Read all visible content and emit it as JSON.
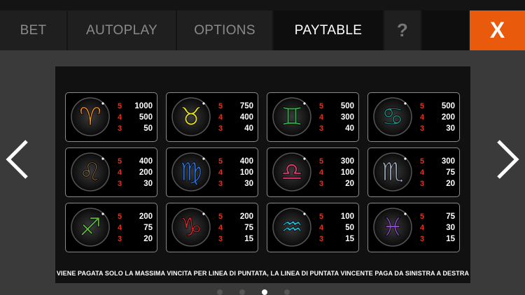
{
  "tabs": {
    "bet": "BET",
    "autoplay": "AUTOPLAY",
    "options": "OPTIONS",
    "paytable": "PAYTABLE",
    "help": "?",
    "close": "X"
  },
  "paytable": {
    "note": "VIENE PAGATA SOLO LA MASSIMA VINCITA PER LINEA DI PUNTATA, LA LINEA DI PUNTATA VINCENTE PAGA DA SINISTRA A DESTRA",
    "multipliers": [
      "5",
      "4",
      "3"
    ],
    "symbols": [
      {
        "icon": "aries-icon",
        "color": "#e08a1e",
        "glyph": "♈",
        "pays": [
          "1000",
          "500",
          "50"
        ]
      },
      {
        "icon": "taurus-icon",
        "color": "#e6e01c",
        "glyph": "♉",
        "pays": [
          "750",
          "400",
          "40"
        ]
      },
      {
        "icon": "gemini-icon",
        "color": "#2fae4a",
        "glyph": "♊",
        "pays": [
          "500",
          "300",
          "40"
        ]
      },
      {
        "icon": "cancer-icon",
        "color": "#1f8f84",
        "glyph": "♋",
        "pays": [
          "500",
          "200",
          "30"
        ]
      },
      {
        "icon": "leo-icon",
        "color": "#8a6a3e",
        "glyph": "♌",
        "pays": [
          "400",
          "200",
          "30"
        ]
      },
      {
        "icon": "virgo-icon",
        "color": "#2a6fd6",
        "glyph": "♍",
        "pays": [
          "400",
          "100",
          "30"
        ]
      },
      {
        "icon": "libra-icon",
        "color": "#e23a76",
        "glyph": "♎",
        "pays": [
          "300",
          "100",
          "20"
        ]
      },
      {
        "icon": "scorpio-icon",
        "color": "#9aa4b8",
        "glyph": "♏",
        "pays": [
          "300",
          "75",
          "20"
        ]
      },
      {
        "icon": "sagittarius-icon",
        "color": "#5cb83a",
        "glyph": "♐",
        "pays": [
          "200",
          "75",
          "20"
        ]
      },
      {
        "icon": "capricorn-icon",
        "color": "#d8242a",
        "glyph": "♑",
        "pays": [
          "200",
          "75",
          "15"
        ]
      },
      {
        "icon": "aquarius-icon",
        "color": "#23b6d6",
        "glyph": "♒",
        "pays": [
          "100",
          "50",
          "15"
        ]
      },
      {
        "icon": "pisces-icon",
        "color": "#8a48c8",
        "glyph": "♓",
        "pays": [
          "75",
          "30",
          "15"
        ]
      }
    ]
  },
  "colors": {
    "accent": "#ea5a0c",
    "multiplier": "#e0321c"
  },
  "pager": {
    "pages": 4,
    "current": 3
  }
}
